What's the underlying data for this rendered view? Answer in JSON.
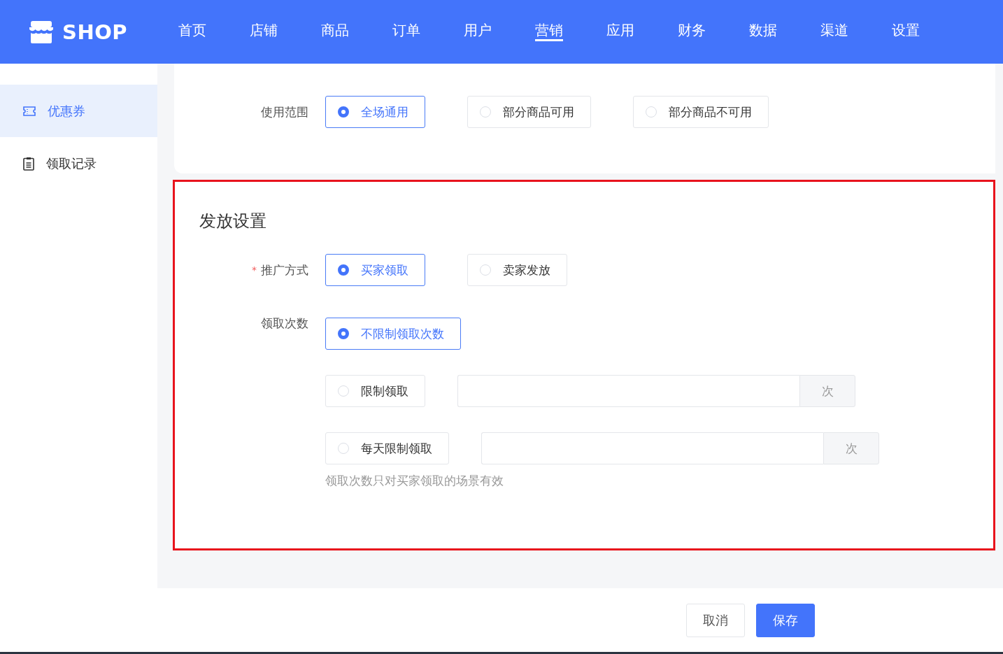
{
  "header": {
    "logo": "SHOP",
    "nav": [
      {
        "label": "首页",
        "selected": false
      },
      {
        "label": "店铺",
        "selected": false
      },
      {
        "label": "商品",
        "selected": false
      },
      {
        "label": "订单",
        "selected": false
      },
      {
        "label": "用户",
        "selected": false
      },
      {
        "label": "营销",
        "selected": true
      },
      {
        "label": "应用",
        "selected": false
      },
      {
        "label": "财务",
        "selected": false
      },
      {
        "label": "数据",
        "selected": false
      },
      {
        "label": "渠道",
        "selected": false
      },
      {
        "label": "设置",
        "selected": false
      }
    ]
  },
  "sidebar": {
    "items": [
      {
        "label": "优惠券",
        "selected": true
      },
      {
        "label": "领取记录",
        "selected": false
      }
    ]
  },
  "scope": {
    "label": "使用范围",
    "kind": "inline",
    "options": [
      {
        "label": "全场通用",
        "selected": true,
        "kind": "plain"
      },
      {
        "label": "部分商品可用",
        "selected": false,
        "kind": "plain"
      },
      {
        "label": "部分商品不可用",
        "selected": false,
        "kind": "plain"
      }
    ]
  },
  "issue_settings": {
    "title": "发放设置",
    "fields": [
      {
        "label": "推广方式",
        "required_mark": "*",
        "kind": "inline",
        "options": [
          {
            "label": "买家领取",
            "selected": true,
            "kind": "plain"
          },
          {
            "label": "卖家发放",
            "selected": false,
            "kind": "plain"
          }
        ]
      },
      {
        "label": "领取次数",
        "kind": "stacked",
        "options": [
          {
            "label": "不限制领取次数",
            "selected": true,
            "kind": "plain"
          },
          {
            "label": "限制领取",
            "selected": false,
            "kind": "count",
            "suffix": "次"
          },
          {
            "label": "每天限制领取",
            "selected": false,
            "kind": "count",
            "suffix": "次"
          }
        ],
        "hint": "领取次数只对买家领取的场景有效"
      }
    ]
  },
  "footer": {
    "buttons": [
      {
        "label": "取消",
        "kind": "default"
      },
      {
        "label": "保存",
        "kind": "primary"
      }
    ]
  }
}
